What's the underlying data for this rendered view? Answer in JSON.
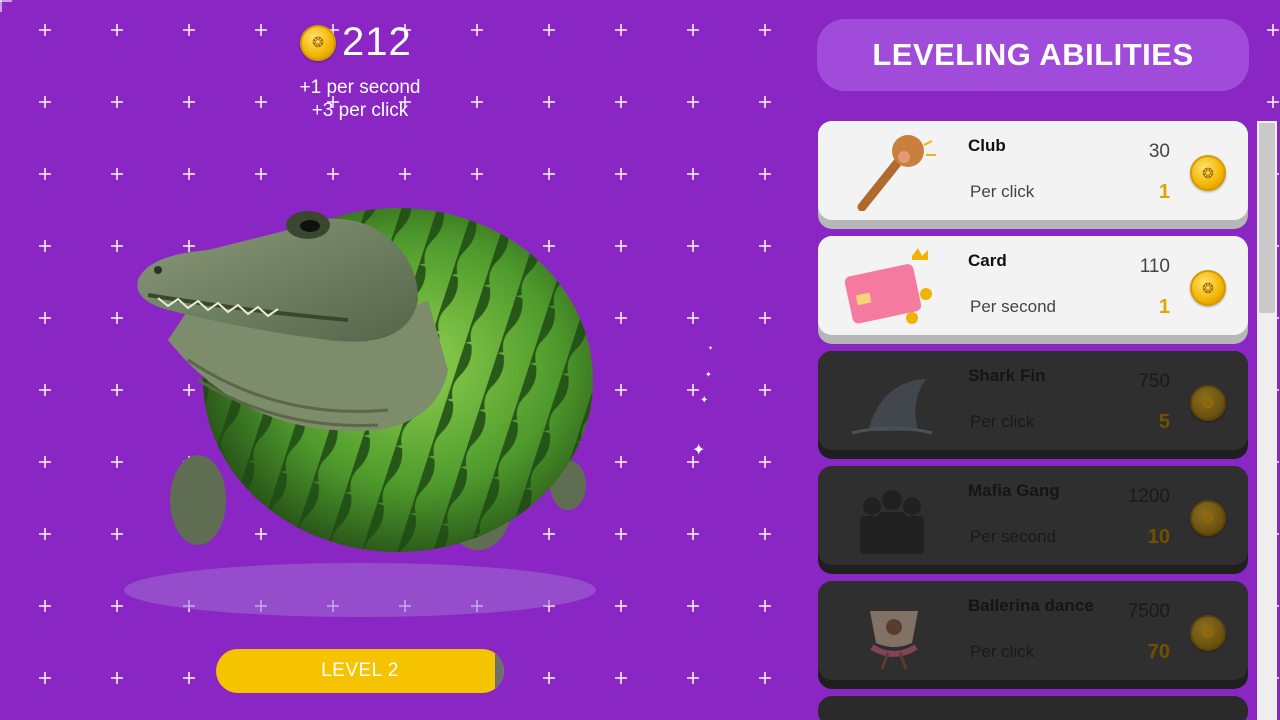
{
  "hud": {
    "coins": "212",
    "per_second": "+1 per second",
    "per_click": "+3 per click"
  },
  "level": {
    "label": "LEVEL 2",
    "progress": 0.97
  },
  "panel": {
    "title": "LEVELING ABILITIES"
  },
  "abilities": [
    {
      "name": "Club",
      "cost": "30",
      "type": "Per click",
      "gain": "1",
      "locked": false,
      "icon": "club-icon"
    },
    {
      "name": "Card",
      "cost": "110",
      "type": "Per second",
      "gain": "1",
      "locked": false,
      "icon": "credit-card-icon"
    },
    {
      "name": "Shark Fin",
      "cost": "750",
      "type": "Per click",
      "gain": "5",
      "locked": true,
      "icon": "shark-fin-icon"
    },
    {
      "name": "Mafia Gang",
      "cost": "1200",
      "type": "Per second",
      "gain": "10",
      "locked": true,
      "icon": "mafia-gang-icon"
    },
    {
      "name": "Ballerina dance",
      "cost": "7500",
      "type": "Per click",
      "gain": "70",
      "locked": true,
      "icon": "ballerina-cup-icon"
    }
  ],
  "colors": {
    "background": "#8a26c4",
    "header": "#a04bd9",
    "gold": "#f5c300",
    "card_unlocked": "#f3f3f3",
    "card_locked": "#2f2f2f"
  }
}
